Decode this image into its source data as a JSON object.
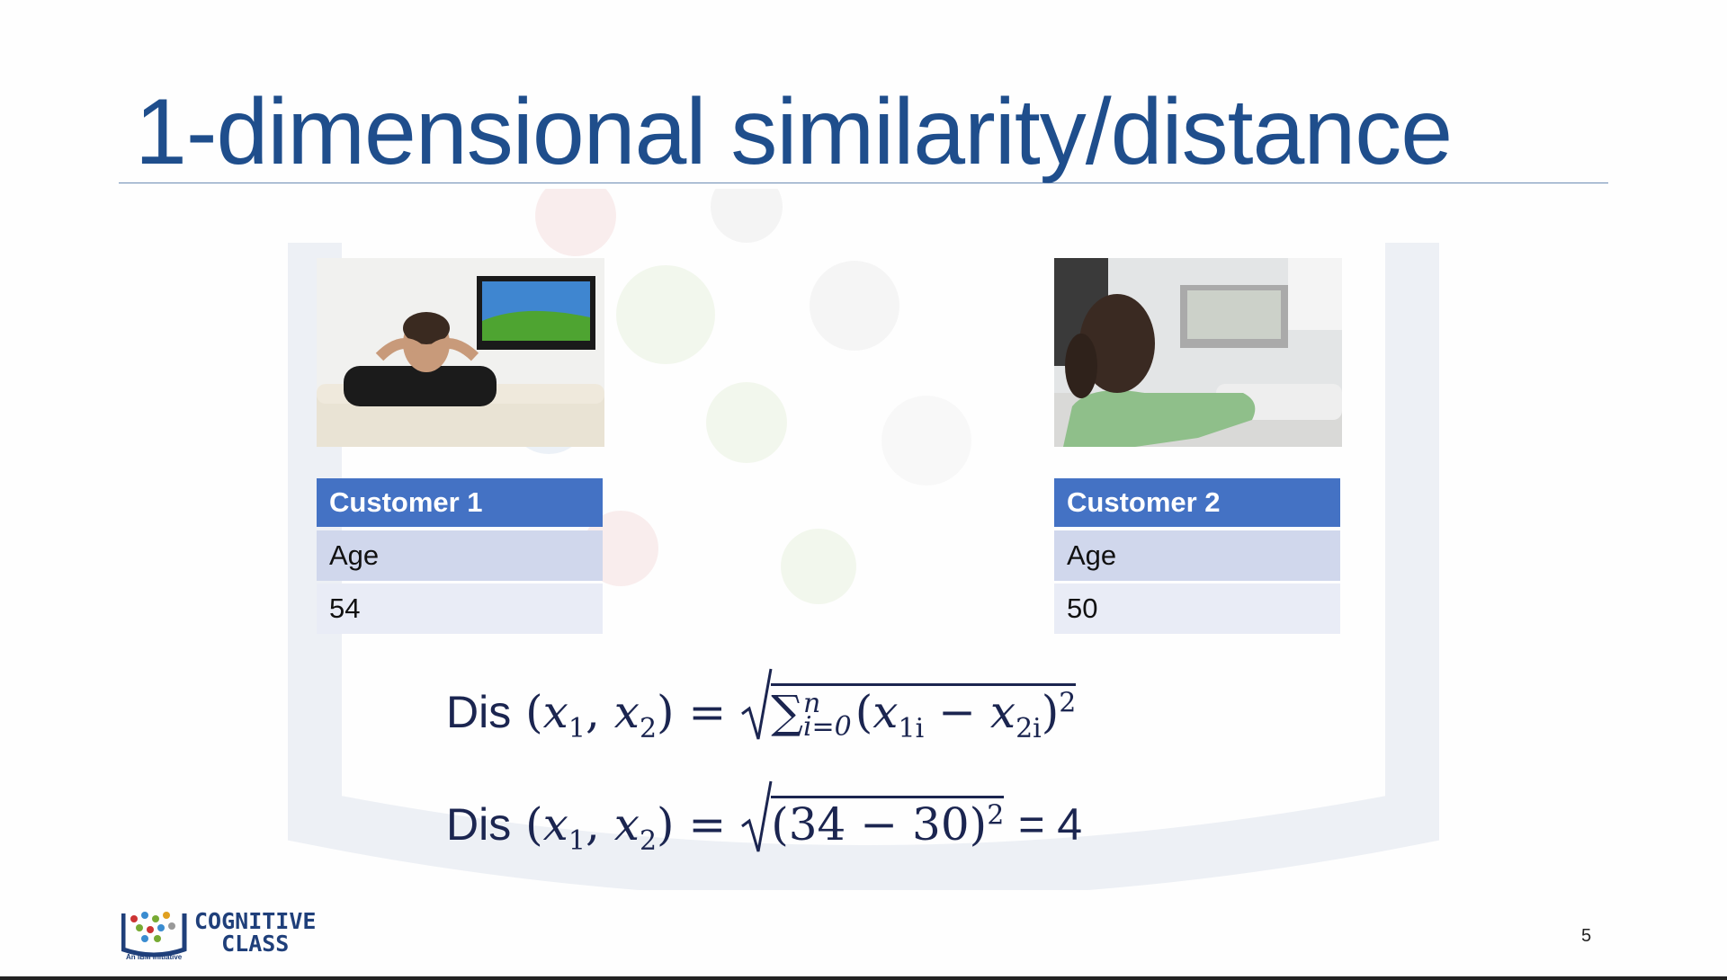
{
  "slide": {
    "title": "1-dimensional similarity/distance",
    "page_number": "5"
  },
  "customers": [
    {
      "header": "Customer 1",
      "attribute": "Age",
      "value": "54",
      "image": "man-watching-tv-photo"
    },
    {
      "header": "Customer 2",
      "attribute": "Age",
      "value": "50",
      "image": "woman-watching-tv-photo"
    }
  ],
  "formulas": {
    "label": "Dis",
    "general": {
      "x1": "x",
      "x1_sub": "1",
      "x2": "x",
      "x2_sub": "2",
      "sum": "∑",
      "sum_upper": "n",
      "sum_lower": "i=0",
      "term_a": "x",
      "term_a_sub": "1i",
      "term_b": "x",
      "term_b_sub": "2i",
      "exponent": "2"
    },
    "specific": {
      "expression": "(34 − 30)",
      "exponent": "2",
      "result": "= 4"
    }
  },
  "logo": {
    "line1": "COGNITIVE",
    "line2": "CLASS",
    "tagline": "An IBM Initiative"
  },
  "colors": {
    "title": "#1f4e8c",
    "table_header": "#4472c4",
    "table_row1": "#d0d7ec",
    "table_row2": "#e9ecf6",
    "formula": "#1b2550"
  }
}
